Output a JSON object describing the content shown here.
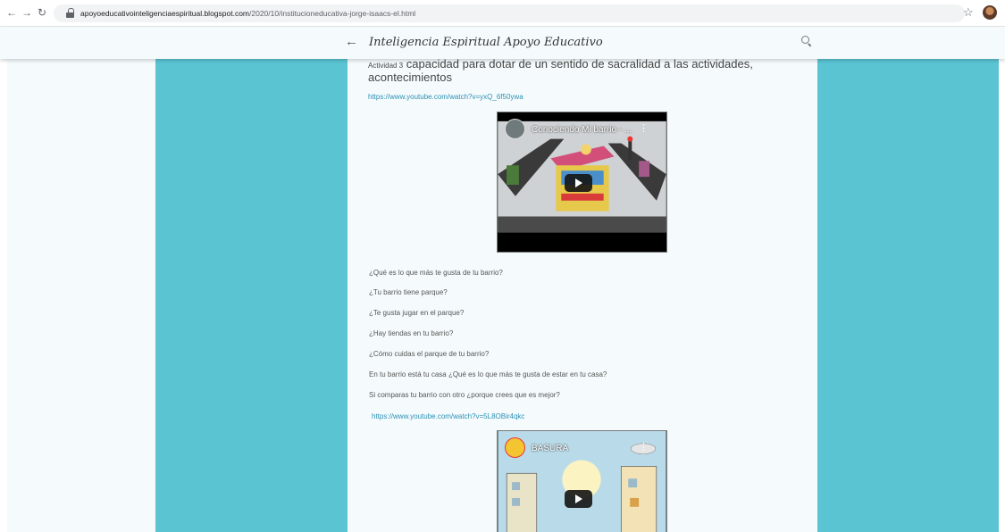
{
  "browser": {
    "url_domain": "apoyoeducativointeligenciaespiritual.blogspot.com",
    "url_path": "/2020/10/institucioneducativa-jorge-isaacs-el.html"
  },
  "blog": {
    "title": "Inteligencia Espiritual Apoyo Educativo"
  },
  "post": {
    "heading_prefix": "Actividad 3",
    "heading_text": " capacidad para dotar de un sentido de sacralidad a las actividades, acontecimientos",
    "link1": "https://www.youtube.com/watch?v=yxQ_6f50ywa",
    "video1": {
      "title": "Conociendo Mi barrio - ..."
    },
    "questions": [
      "¿Qué es lo que más te gusta de tu barrio?",
      "¿Tu barrio tiene parque?",
      "¿Te gusta jugar en el parque?",
      "¿Hay tiendas en tu barrio?",
      "¿Cómo cuidas el parque de tu barrio?",
      "En tu barrio está tu casa ¿Qué es lo que más te gusta de estar en tu casa?",
      "Si comparas tu barrio con otro ¿porque crees que es mejor?"
    ],
    "link2": "https://www.youtube.com/watch?v=5L8OBir4qkc",
    "video2": {
      "title": "BASURA"
    }
  },
  "colors": {
    "teal": "#5bc4d3",
    "post_bg": "#f5fbfc",
    "link": "#2d8fb4"
  },
  "icons": [
    "back-icon",
    "forward-icon",
    "reload-icon",
    "lock-icon",
    "star-icon",
    "search-icon",
    "play-icon",
    "more-icon"
  ]
}
